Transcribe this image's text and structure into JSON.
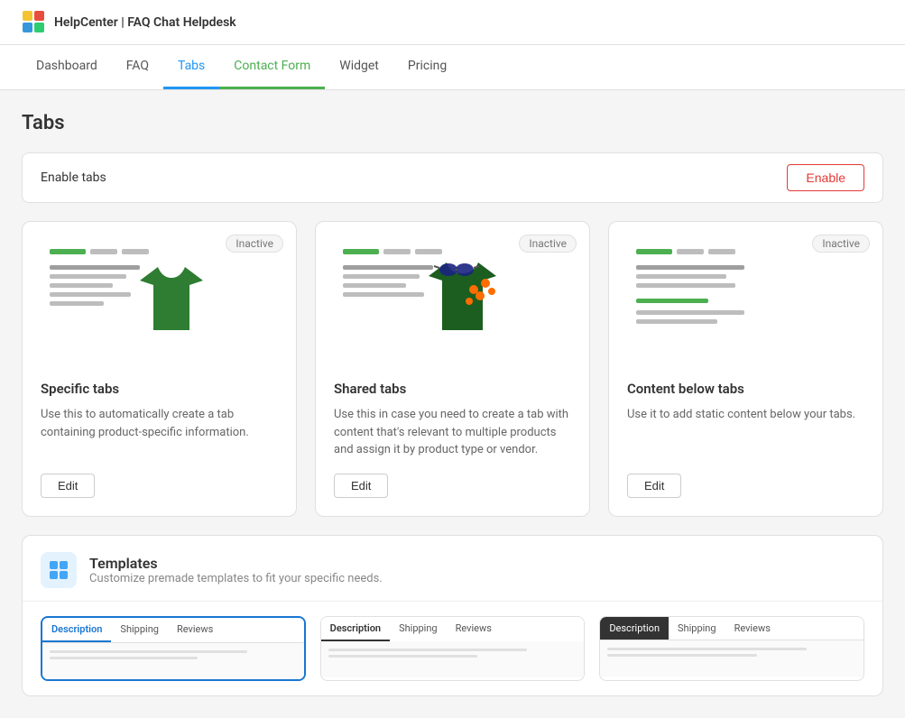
{
  "app": {
    "logo_text": "HelpCenter | FAQ Chat Helpdesk",
    "logo_icon": "grid-icon"
  },
  "nav": {
    "items": [
      {
        "id": "dashboard",
        "label": "Dashboard",
        "active": false
      },
      {
        "id": "faq",
        "label": "FAQ",
        "active": false
      },
      {
        "id": "tabs",
        "label": "Tabs",
        "active": true,
        "color": "blue"
      },
      {
        "id": "contact-form",
        "label": "Contact Form",
        "active": true,
        "color": "green"
      },
      {
        "id": "widget",
        "label": "Widget",
        "active": false
      },
      {
        "id": "pricing",
        "label": "Pricing",
        "active": false
      }
    ]
  },
  "page": {
    "title": "Tabs"
  },
  "enable_row": {
    "label": "Enable tabs",
    "button_label": "Enable"
  },
  "cards": [
    {
      "id": "specific-tabs",
      "badge": "Inactive",
      "title": "Specific tabs",
      "description": "Use this to automatically create a tab containing product-specific information.",
      "edit_label": "Edit"
    },
    {
      "id": "shared-tabs",
      "badge": "Inactive",
      "title": "Shared tabs",
      "description": "Use this in case you need to create a tab with content that's relevant to multiple products and assign it by product type or vendor.",
      "edit_label": "Edit"
    },
    {
      "id": "content-below-tabs",
      "badge": "Inactive",
      "title": "Content below tabs",
      "description": "Use it to add static content below your tabs.",
      "edit_label": "Edit"
    }
  ],
  "templates": {
    "icon": "grid-icon",
    "title": "Templates",
    "subtitle": "Customize premade templates to fit your specific needs.",
    "cards": [
      {
        "id": "tmpl-blue",
        "style": "blue-border",
        "tabs": [
          "Description",
          "Shipping",
          "Reviews"
        ],
        "active_tab": "Description"
      },
      {
        "id": "tmpl-underline",
        "style": "underline",
        "tabs": [
          "Description",
          "Shipping",
          "Reviews"
        ],
        "active_tab": "Description"
      },
      {
        "id": "tmpl-dark",
        "style": "dark",
        "tabs": [
          "Description",
          "Shipping",
          "Reviews"
        ],
        "active_tab": "Description"
      }
    ]
  }
}
